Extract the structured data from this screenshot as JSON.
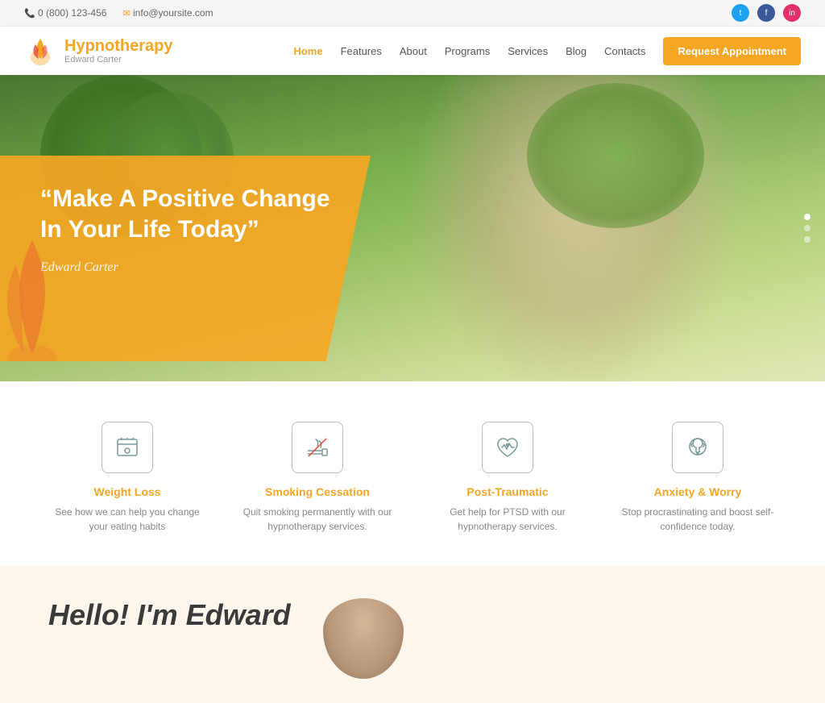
{
  "topbar": {
    "phone": "0 (800) 123-456",
    "email": "info@yoursite.com"
  },
  "header": {
    "logo_name": "Hypnotherapy",
    "logo_sub": "Edward Carter",
    "nav": [
      "Home",
      "Features",
      "About",
      "Programs",
      "Services",
      "Blog",
      "Contacts"
    ],
    "active_nav": "Home",
    "cta_label": "Request Appointment"
  },
  "hero": {
    "quote": "“Make A Positive Change In Your Life Today”",
    "author": "Edward Carter"
  },
  "dots": [
    "active",
    "inactive",
    "inactive"
  ],
  "services": [
    {
      "icon": "scale",
      "title": "Weight Loss",
      "desc": "See how we can help you change your eating habits"
    },
    {
      "icon": "no-smoking",
      "title": "Smoking Cessation",
      "desc": "Quit smoking permanently with our hypnotherapy services."
    },
    {
      "icon": "heart-pulse",
      "title": "Post-Traumatic",
      "desc": "Get help for PTSD with our hypnotherapy services."
    },
    {
      "icon": "head-brain",
      "title": "Anxiety & Worry",
      "desc": "Stop procrastinating and boost self-confidence today."
    }
  ],
  "hello": {
    "title": "Hello! I'm Edward"
  }
}
